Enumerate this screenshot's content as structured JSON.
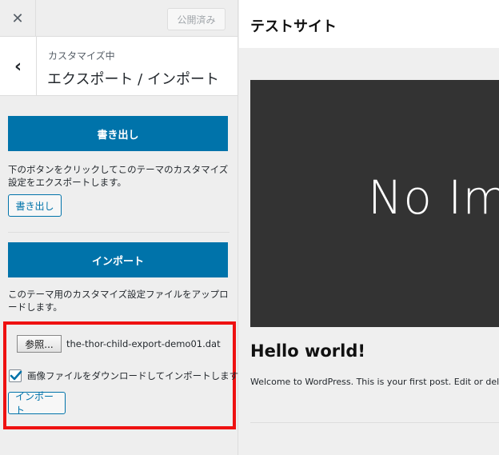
{
  "topbar": {
    "close_glyph": "✕",
    "publish_label": "公開済み"
  },
  "section": {
    "back_glyph": "‹",
    "subtitle": "カスタマイズ中",
    "title": "エクスポート / インポート"
  },
  "export": {
    "big_button": "書き出し",
    "description": "下のボタンをクリックしてこのテーマのカスタマイズ設定をエクスポートします。",
    "small_button": "書き出し"
  },
  "import": {
    "big_button": "インポート",
    "description": "このテーマ用のカスタマイズ設定ファイルをアップロードします。",
    "browse_button": "参照...",
    "file_name": "the-thor-child-export-demo01.dat",
    "checkbox_checked": true,
    "checkbox_label": "画像ファイルをダウンロードしてインポートしますか ?",
    "small_button": "インポート"
  },
  "preview": {
    "site_title": "テストサイト",
    "no_image_text": "No Im",
    "post_title": "Hello world!",
    "post_excerpt": "Welcome to WordPress. This is your first post. Edit or delete"
  },
  "colors": {
    "accent": "#0073aa",
    "highlight": "#ee1111",
    "no_image_bg": "#333333"
  }
}
